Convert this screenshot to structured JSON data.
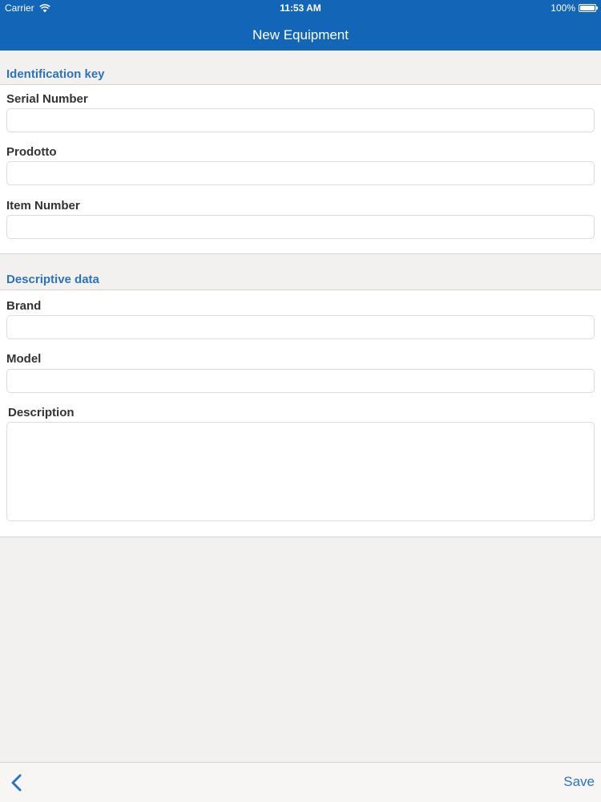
{
  "status_bar": {
    "carrier": "Carrier",
    "time": "11:53 AM",
    "battery": "100%",
    "wifi_icon": "wifi-icon",
    "battery_icon": "battery-icon"
  },
  "nav": {
    "title": "New Equipment"
  },
  "sections": {
    "identification": {
      "title": "Identification key",
      "serial_number": {
        "label": "Serial Number",
        "value": ""
      },
      "prodotto": {
        "label": "Prodotto",
        "value": ""
      },
      "item_number": {
        "label": "Item Number",
        "value": ""
      }
    },
    "descriptive": {
      "title": "Descriptive data",
      "brand": {
        "label": "Brand",
        "value": ""
      },
      "model": {
        "label": "Model",
        "value": ""
      },
      "description": {
        "label": "Description",
        "value": ""
      }
    }
  },
  "toolbar": {
    "back_icon": "chevron-left-icon",
    "save_label": "Save"
  },
  "colors": {
    "bar_blue": "#1265b7",
    "accent_blue": "#2a74be",
    "background": "#f3f1ef"
  }
}
